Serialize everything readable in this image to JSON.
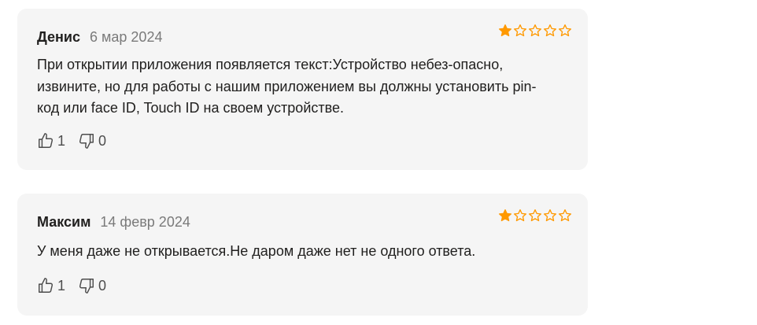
{
  "colors": {
    "star_filled": "#ff9900",
    "star_empty": "#ff9900",
    "card_bg": "#f5f5f5"
  },
  "reviews": [
    {
      "author": "Денис",
      "date": "6 мар 2024",
      "rating": 1,
      "max_rating": 5,
      "text": "При открытии приложения появляется текст:Устройство небез-опасно, извините, но для работы с нашим приложением вы должны установить pin-код или face ID, Touch ID на своем устройстве.",
      "likes": "1",
      "dislikes": "0"
    },
    {
      "author": "Максим",
      "date": "14 февр 2024",
      "rating": 1,
      "max_rating": 5,
      "text": "У меня даже не открывается.Не даром даже нет не одного ответа.",
      "likes": "1",
      "dislikes": "0"
    }
  ]
}
